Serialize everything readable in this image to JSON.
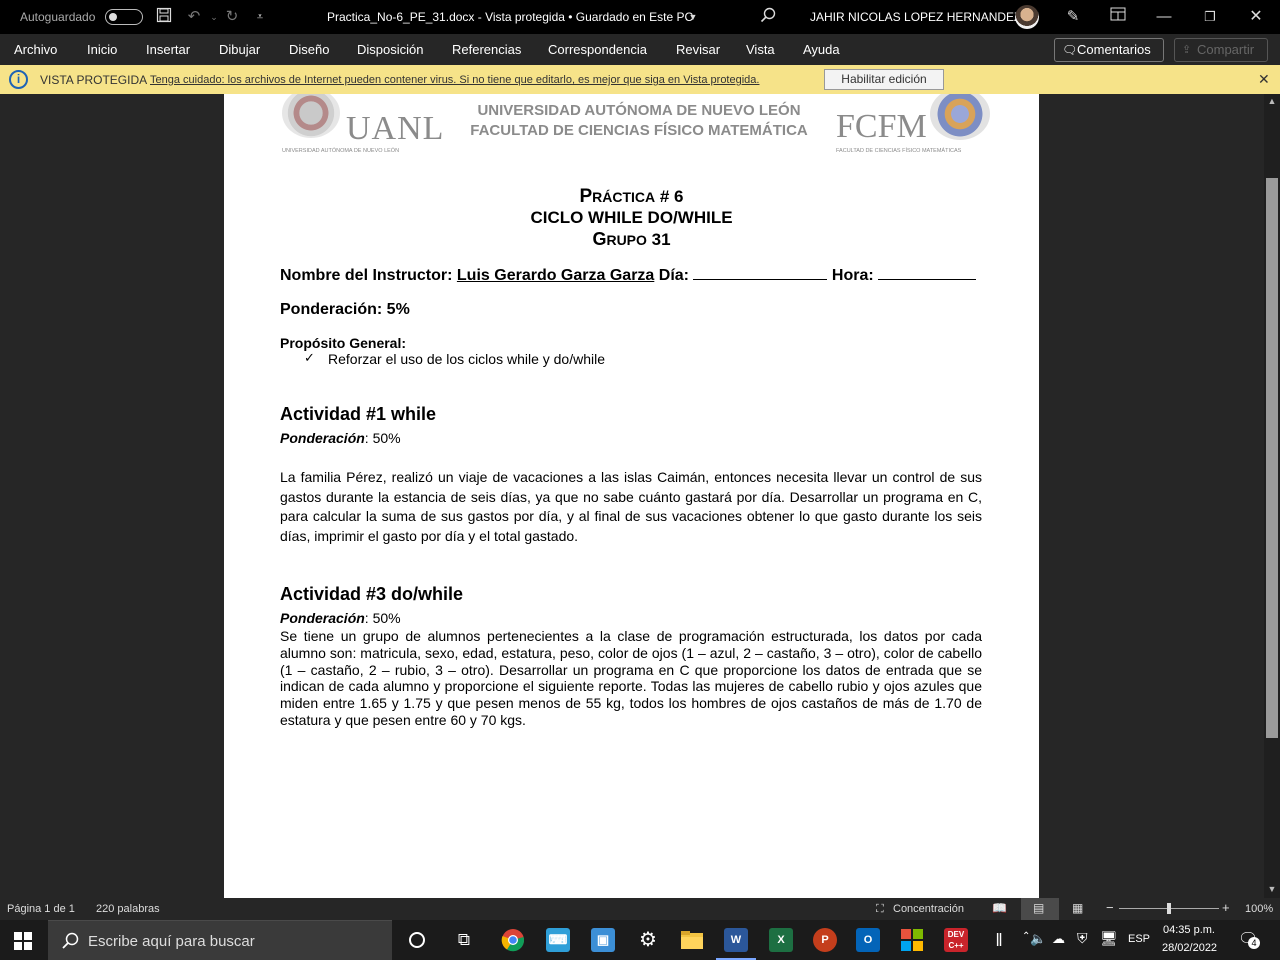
{
  "titlebar": {
    "autosave_label": "Autoguardado",
    "document_title": "Practica_No-6_PE_31.docx  -  Vista protegida • Guardado en Este PC",
    "user_name": "JAHIR NICOLAS LOPEZ HERNANDEZ"
  },
  "menu": {
    "items": [
      "Archivo",
      "Inicio",
      "Insertar",
      "Dibujar",
      "Diseño",
      "Disposición",
      "Referencias",
      "Correspondencia",
      "Revisar",
      "Vista",
      "Ayuda"
    ],
    "comments_label": "Comentarios",
    "share_label": "Compartir"
  },
  "protected_view": {
    "title": "VISTA PROTEGIDA",
    "message": "Tenga cuidado: los archivos de Internet pueden contener virus. Si no tiene que editarlo, es mejor que siga en Vista protegida.",
    "enable_button": "Habilitar edición"
  },
  "document": {
    "header": {
      "uanl_logo_text": "UANL",
      "uanl_logo_subtext": "UNIVERSIDAD AUTÓNOMA DE NUEVO LEÓN",
      "line1": "UNIVERSIDAD AUTÓNOMA DE NUEVO LEÓN",
      "line2": "FACULTAD DE CIENCIAS FÍSICO MATEMÁTICA",
      "fcfm_logo_text": "FCFM",
      "fcfm_logo_subtext": "FACULTAD DE CIENCIAS FÍSICO MATEMÁTICAS"
    },
    "title_practice": "PRÁCTICA # 6",
    "title_main": "CICLO WHILE DO/WHILE",
    "title_group": "GRUPO 31",
    "instructor_label": "Nombre del Instructor: ",
    "instructor_name": "Luis Gerardo Garza Garza",
    "day_label": " Día: ",
    "hour_label": " Hora: ",
    "weight_label": "Ponderación: 5%",
    "purpose_label": "Propósito General:",
    "purpose_item": "Reforzar el uso de los ciclos while y do/while",
    "activity1_title": "Actividad #1 while",
    "activity1_weight_label": "Ponderación",
    "activity1_weight_value": ": 50%",
    "activity1_text": "La familia Pérez, realizó un viaje de vacaciones a las islas Caimán, entonces necesita llevar un control de sus gastos durante la estancia de seis días, ya que no sabe cuánto gastará por día. Desarrollar un programa en C, para calcular la suma de sus gastos por día, y al final de sus vacaciones obtener lo que gasto durante los seis días, imprimir el gasto por día y el total gastado.",
    "activity3_title": "Actividad #3 do/while",
    "activity3_weight_label": "Ponderación",
    "activity3_weight_value": ": 50%",
    "activity3_text": "Se tiene un grupo de alumnos pertenecientes a la clase de programación estructurada, los datos por cada alumno son: matricula, sexo, edad, estatura, peso, color de ojos (1 – azul, 2 – castaño, 3 – otro), color de cabello (1 – castaño, 2 – rubio, 3 – otro). Desarrollar un programa en C que proporcione los datos de entrada que se indican de cada alumno y proporcione el siguiente reporte. Todas las mujeres de cabello rubio y ojos azules que miden entre 1.65 y 1.75 y que pesen menos de 55 kg, todos los hombres de ojos castaños de más de 1.70 de estatura y que pesen entre 60 y 70 kgs."
  },
  "statusbar": {
    "page": "Página 1 de 1",
    "words": "220 palabras",
    "focus": "Concentración",
    "zoom": "100%",
    "zoom_level": 0.5
  },
  "taskbar": {
    "search_placeholder": "Escribe aquí para buscar",
    "language": "ESP",
    "time": "04:35 p.m.",
    "date": "28/02/2022",
    "notifications": "4"
  },
  "colors": {
    "word_blue": "#2b579a",
    "excel_green": "#1d6f42",
    "ppt_orange": "#c43e1c",
    "outlook_blue": "#0364b8",
    "pv_yellow": "#f6e389"
  }
}
